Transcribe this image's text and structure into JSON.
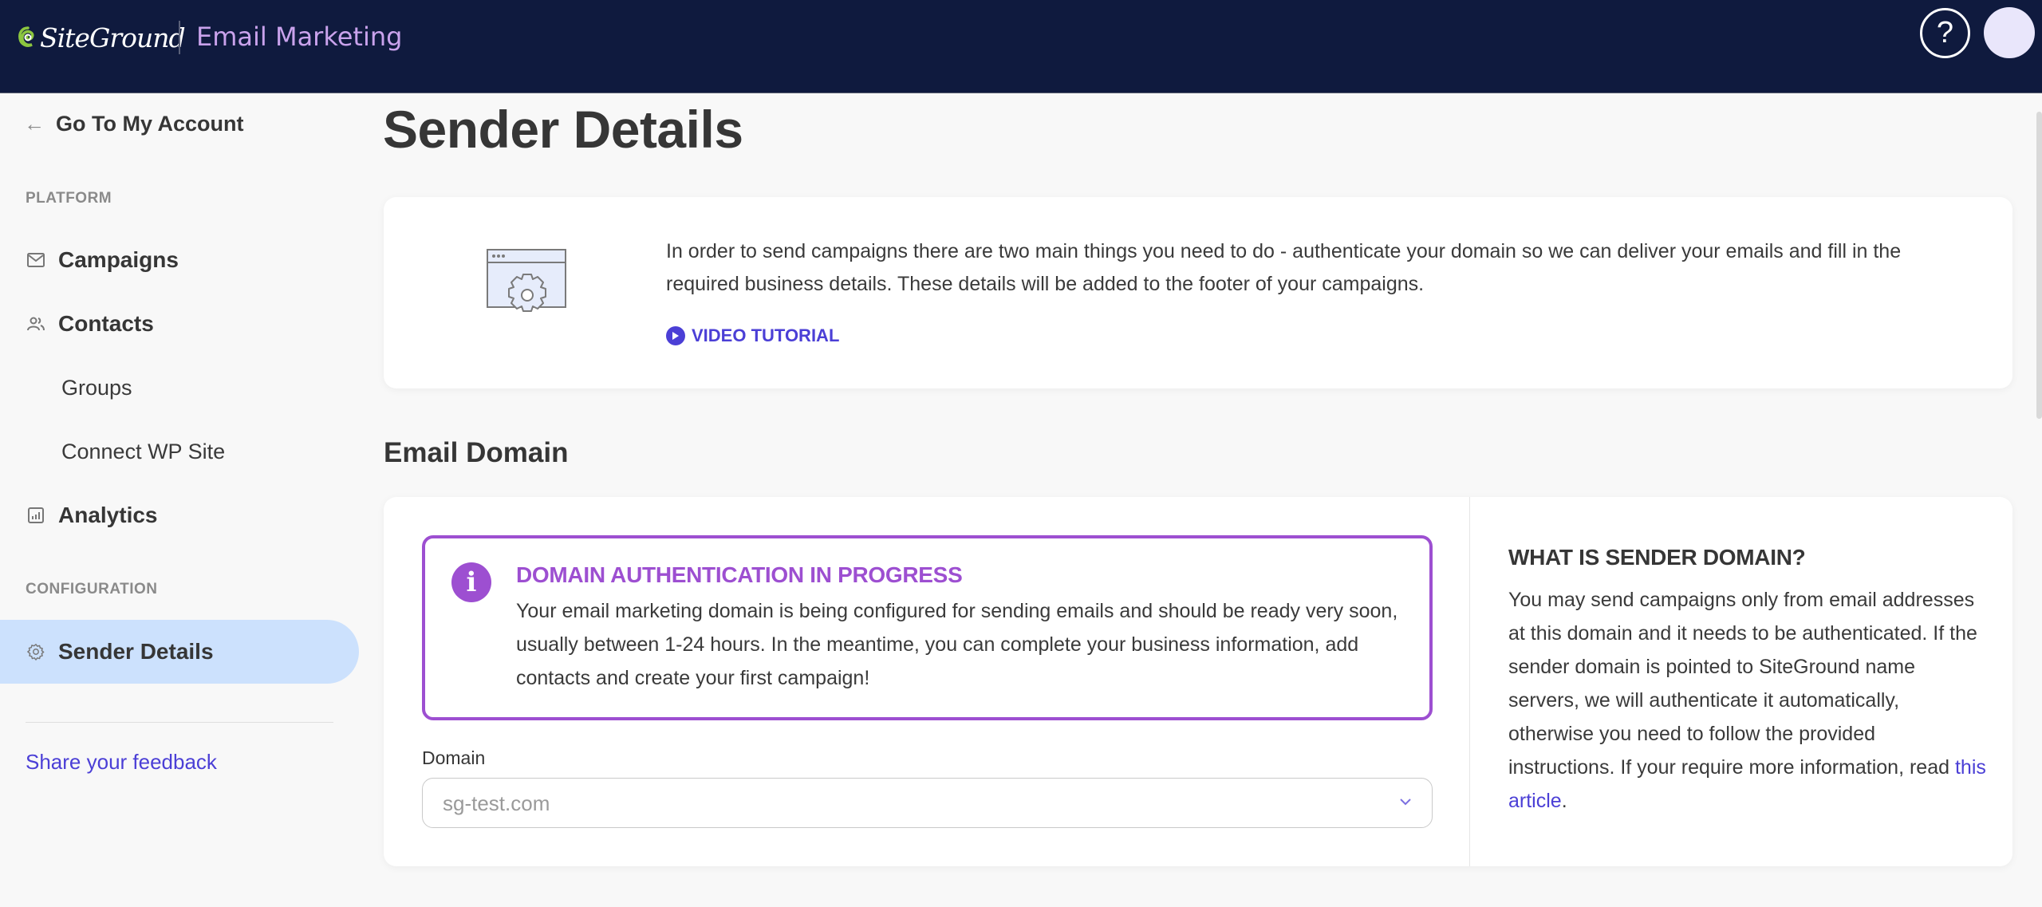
{
  "header": {
    "brand": "SiteGround",
    "app_title": "Email Marketing",
    "help_icon": "question-circle-icon",
    "avatar_icon": "user-avatar"
  },
  "sidebar": {
    "back_label": "Go To My Account",
    "platform_label": "PLATFORM",
    "configuration_label": "CONFIGURATION",
    "items": [
      {
        "label": "Campaigns",
        "icon": "envelope-icon"
      },
      {
        "label": "Contacts",
        "icon": "users-icon"
      },
      {
        "label": "Groups"
      },
      {
        "label": "Connect WP Site"
      },
      {
        "label": "Analytics",
        "icon": "chart-icon"
      },
      {
        "label": "Sender Details",
        "icon": "gear-icon",
        "active": true
      }
    ],
    "feedback_label": "Share your feedback"
  },
  "main": {
    "page_title": "Sender Details",
    "intro": {
      "text": "In order to send campaigns there are two main things you need to do - authenticate your domain so we can deliver your emails and fill in the required business details. These details will be added to the footer of your campaigns.",
      "video_label": "VIDEO TUTORIAL"
    },
    "email_domain": {
      "section_title": "Email Domain",
      "notice": {
        "title": "DOMAIN AUTHENTICATION IN PROGRESS",
        "body": "Your email marketing domain is being configured for sending emails and should be ready very soon, usually between 1-24 hours. In the meantime, you can complete your business information, add contacts and create your first campaign!"
      },
      "domain_label": "Domain",
      "domain_value": "sg-test.com",
      "info": {
        "title": "WHAT IS SENDER DOMAIN?",
        "body": "You may send campaigns only from email addresses at this domain and it needs to be authenticated. If the sender domain is pointed to SiteGround name servers, we will authenticate it automatically, otherwise you need to follow the provided instructions. If your require more information, read ",
        "link_label": "this article",
        "suffix": "."
      }
    }
  },
  "colors": {
    "topbar": "#0f1a3e",
    "accent": "#4b3fd6",
    "notice": "#9d4fd1",
    "active_nav": "#cce1fd"
  }
}
